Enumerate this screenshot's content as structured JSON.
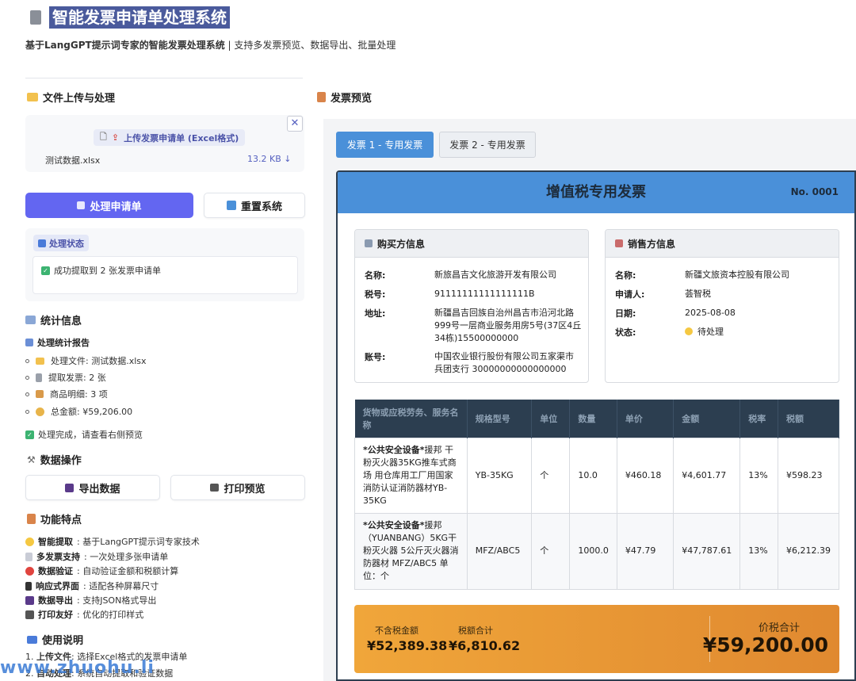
{
  "app": {
    "title": "智能发票申请单处理系统",
    "subtitle_bold": "基于LangGPT提示词专家的智能发票处理系统",
    "subtitle_rest": " | 支持多发票预览、数据导出、批量处理"
  },
  "left": {
    "upload_section_title": "文件上传与处理",
    "upload_button_label": "上传发票申请单 (Excel格式)",
    "close_label": "✕",
    "file_name": "测试数据.xlsx",
    "file_size": "13.2 KB ↓",
    "process_button": "处理申请单",
    "reset_button": "重置系统",
    "status_tag": "处理状态",
    "status_message": "成功提取到 2 张发票申请单",
    "stats_title": "统计信息",
    "report_title": "处理统计报告",
    "stats_items": [
      "处理文件: 测试数据.xlsx",
      "提取发票: 2 张",
      "商品明细: 3 项",
      "总金额: ¥59,206.00"
    ],
    "done_message": "处理完成，请查看右侧预览",
    "data_ops_title": "数据操作",
    "export_button": "导出数据",
    "print_button": "打印预览",
    "features_title": "功能特点",
    "features": [
      {
        "name": "智能提取",
        "desc": ": 基于LangGPT提示词专家技术"
      },
      {
        "name": "多发票支持",
        "desc": ": 一次处理多张申请单"
      },
      {
        "name": "数据验证",
        "desc": ": 自动验证金额和税额计算"
      },
      {
        "name": "响应式界面",
        "desc": ": 适配各种屏幕尺寸"
      },
      {
        "name": "数据导出",
        "desc": ": 支持JSON格式导出"
      },
      {
        "name": "打印友好",
        "desc": ": 优化的打印样式"
      }
    ],
    "usage_title": "使用说明",
    "usage_items": [
      {
        "num": "1. ",
        "name": "上传文件",
        "desc": ": 选择Excel格式的发票申请单"
      },
      {
        "num": "2. ",
        "name": "自动处理",
        "desc": ": 系统自动提取和验证数据"
      }
    ],
    "watermark": "www.zhuohu.li"
  },
  "right": {
    "preview_title": "发票预览",
    "tabs": [
      "发票 1 - 专用发票",
      "发票 2 - 专用发票"
    ],
    "invoice": {
      "title": "增值税专用发票",
      "number": "No. 0001",
      "buyer": {
        "title": "购买方信息",
        "name_k": "名称:",
        "name_v": "新旅昌吉文化旅游开发有限公司",
        "tax_k": "税号:",
        "tax_v": "91111111111111111B",
        "addr_k": "地址:",
        "addr_v": "新疆昌吉回族自治州昌吉市沿河北路999号一层商业服务用房5号(37区4丘34栋)15500000000",
        "acct_k": "账号:",
        "acct_v": "中国农业银行股份有限公司五家渠市兵团支行 30000000000000000"
      },
      "seller": {
        "title": "销售方信息",
        "name_k": "名称:",
        "name_v": "新疆文旅资本控股有限公司",
        "applicant_k": "申请人:",
        "applicant_v": "荟智税",
        "date_k": "日期:",
        "date_v": "2025-08-08",
        "status_k": "状态:",
        "status_v": "待处理"
      },
      "columns": [
        "货物或应税劳务、服务名称",
        "规格型号",
        "单位",
        "数量",
        "单价",
        "金额",
        "税率",
        "税额"
      ],
      "rows": [
        {
          "name_bold": "*公共安全设备*",
          "name_rest": "援邦 干粉灭火器35KG推车式商场 用仓库用工厂用国家消防认证消防器材YB-35KG",
          "spec": "YB-35KG",
          "unit": "个",
          "qty": "10.0",
          "price": "¥460.18",
          "amount": "¥4,601.77",
          "rate": "13%",
          "tax": "¥598.23"
        },
        {
          "name_bold": "*公共安全设备*",
          "name_rest": "援邦（YUANBANG）5KG干粉灭火器 5公斤灭火器消防器材 MFZ/ABC5 单位：个",
          "spec": "MFZ/ABC5",
          "unit": "个",
          "qty": "1000.0",
          "price": "¥47.79",
          "amount": "¥47,787.61",
          "rate": "13%",
          "tax": "¥6,212.39"
        }
      ],
      "totals": {
        "pretax_label": "不含税金额",
        "pretax": "¥52,389.38",
        "tax_label": "税额合计",
        "tax": "¥6,810.62",
        "total_label": "价税合计",
        "total": "¥59,200.00"
      }
    }
  },
  "colors": {
    "primary": "#6366f1",
    "header_blue": "#4a90d9",
    "table_dark": "#2c3e50",
    "total_orange": "#e89a35"
  }
}
